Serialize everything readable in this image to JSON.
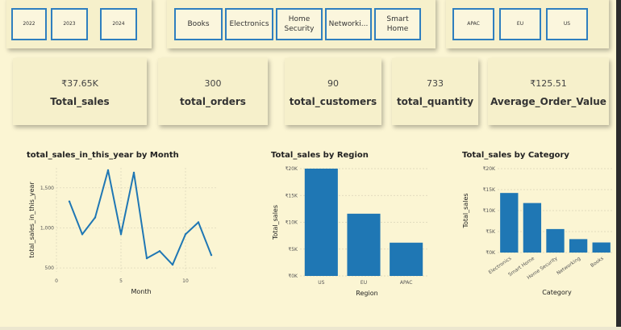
{
  "slicers": {
    "year": {
      "options": [
        "2022",
        "2023",
        "2024"
      ]
    },
    "category": {
      "options": [
        "Books",
        "Electronics",
        "Home Security",
        "Networki...",
        "Smart Home"
      ]
    },
    "region": {
      "options": [
        "APAC",
        "EU",
        "US"
      ]
    }
  },
  "kpis": [
    {
      "value": "₹37.65K",
      "label": "Total_sales"
    },
    {
      "value": "300",
      "label": "total_orders"
    },
    {
      "value": "90",
      "label": "total_customers"
    },
    {
      "value": "733",
      "label": "total_quantity"
    },
    {
      "value": "₹125.51",
      "label": "Average_Order_Value"
    }
  ],
  "colors": {
    "background": "#fbf5d3",
    "card": "#f6f0cb",
    "accent": "#2f7fbf",
    "bar": "#1f77b4"
  },
  "chart_data": [
    {
      "type": "line",
      "title": "total_sales_in_this_year by Month",
      "xlabel": "Month",
      "ylabel": "total_sales_in_this_year",
      "x": [
        1,
        2,
        3,
        4,
        5,
        6,
        7,
        8,
        9,
        10,
        11,
        12
      ],
      "values": [
        1330,
        920,
        1130,
        1720,
        920,
        1690,
        620,
        710,
        540,
        920,
        1070,
        660
      ],
      "xticks": [
        "0",
        "5",
        "10"
      ],
      "yticks": [
        "500",
        "1,000",
        "1,500"
      ],
      "ylim": [
        450,
        1750
      ]
    },
    {
      "type": "bar",
      "title": "Total_sales by Region",
      "xlabel": "Region",
      "ylabel": "Total_sales",
      "categories": [
        "US",
        "EU",
        "APAC"
      ],
      "values": [
        20000,
        11600,
        6200
      ],
      "yticks": [
        "₹0K",
        "₹5K",
        "₹10K",
        "₹15K",
        "₹20K"
      ],
      "ylim": [
        0,
        20000
      ]
    },
    {
      "type": "bar",
      "title": "Total_sales by Category",
      "xlabel": "Category",
      "ylabel": "Total_sales",
      "categories": [
        "Electronics",
        "Smart Home",
        "Home Security",
        "Networking",
        "Books"
      ],
      "values": [
        14200,
        11800,
        5600,
        3200,
        2400
      ],
      "yticks": [
        "₹0K",
        "₹5K",
        "₹10K",
        "₹15K",
        "₹20K"
      ],
      "ylim": [
        0,
        20000
      ]
    }
  ]
}
